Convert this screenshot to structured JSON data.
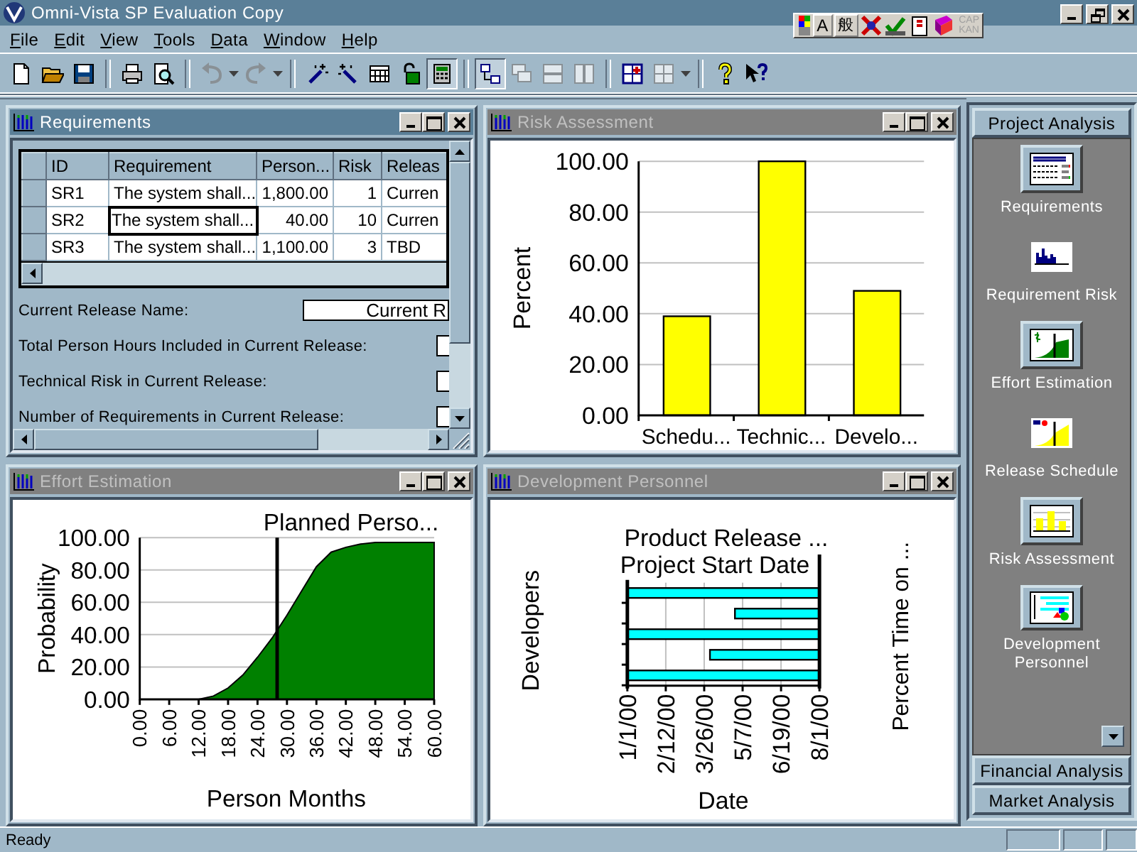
{
  "app": {
    "title": "Omni-Vista SP Evaluation Copy"
  },
  "ime_bar": {
    "mode": "A",
    "input": "般",
    "caps": "CAP",
    "kana": "KAN",
    "locks_disabled": true
  },
  "menu": [
    {
      "label": "File"
    },
    {
      "label": "Edit"
    },
    {
      "label": "View"
    },
    {
      "label": "Tools"
    },
    {
      "label": "Data"
    },
    {
      "label": "Window"
    },
    {
      "label": "Help"
    }
  ],
  "toolbar": [
    {
      "kind": "new",
      "pressed": false,
      "disabled": false
    },
    {
      "kind": "open",
      "pressed": false,
      "disabled": false
    },
    {
      "kind": "save",
      "pressed": false,
      "disabled": false
    },
    {
      "kind": "separator"
    },
    {
      "kind": "print",
      "pressed": false,
      "disabled": false
    },
    {
      "kind": "preview",
      "pressed": false,
      "disabled": false
    },
    {
      "kind": "separator"
    },
    {
      "kind": "undo",
      "pressed": false,
      "disabled": true,
      "dropdown": true
    },
    {
      "kind": "redo",
      "pressed": false,
      "disabled": true,
      "dropdown": true
    },
    {
      "kind": "separator"
    },
    {
      "kind": "wand",
      "pressed": false,
      "disabled": false
    },
    {
      "kind": "wand2",
      "pressed": false,
      "disabled": false
    },
    {
      "kind": "grid",
      "pressed": false,
      "disabled": false
    },
    {
      "kind": "lock",
      "pressed": false,
      "disabled": false
    },
    {
      "kind": "calculator",
      "pressed": true,
      "disabled": false
    },
    {
      "kind": "separator"
    },
    {
      "kind": "diagram",
      "pressed": true,
      "disabled": false
    },
    {
      "kind": "cascade",
      "pressed": false,
      "disabled": true
    },
    {
      "kind": "tileh",
      "pressed": false,
      "disabled": true
    },
    {
      "kind": "tilev",
      "pressed": false,
      "disabled": true
    },
    {
      "kind": "separator"
    },
    {
      "kind": "addwin",
      "pressed": false,
      "disabled": false
    },
    {
      "kind": "layout",
      "pressed": false,
      "disabled": true,
      "dropdown": true
    },
    {
      "kind": "separator"
    },
    {
      "kind": "help",
      "pressed": false,
      "disabled": false
    },
    {
      "kind": "contexthelp",
      "pressed": false,
      "disabled": false
    }
  ],
  "windows": [
    {
      "kind": "table",
      "title": "Requirements",
      "active": true,
      "columns": [
        "ID",
        "Requirement",
        "Person...",
        "Risk",
        "Releas"
      ],
      "rows": [
        {
          "id": "SR1",
          "requirement": "The system shall...",
          "person": "1,800.00",
          "risk": "1",
          "release": "Curren",
          "focused": false
        },
        {
          "id": "SR2",
          "requirement": "The system shall...",
          "person": "40.00",
          "risk": "10",
          "release": "Curren",
          "focused": true
        },
        {
          "id": "SR3",
          "requirement": "The system shall...",
          "person": "1,100.00",
          "risk": "3",
          "release": "TBD",
          "focused": false
        }
      ],
      "fields": [
        {
          "label": "Current Release Name:",
          "value": "Current R"
        },
        {
          "label": "Total Person Hours Included in Current Release:"
        },
        {
          "label": "Technical Risk in Current Release:"
        },
        {
          "label": "Number of Requirements in Current Release:"
        }
      ]
    },
    {
      "kind": "chart",
      "title": "Risk Assessment",
      "active": false,
      "chart_data": {
        "type": "bar",
        "grid": true,
        "ylabel": "Percent",
        "categories": [
          "Schedu...",
          "Technic...",
          "Develo..."
        ],
        "values": [
          39,
          100,
          49
        ],
        "ylim": [
          0,
          100
        ],
        "yticks": [
          {
            "value": 0,
            "label": "0.00"
          },
          {
            "value": 20,
            "label": "20.00"
          },
          {
            "value": 40,
            "label": "40.00"
          },
          {
            "value": 60,
            "label": "60.00"
          },
          {
            "value": 80,
            "label": "80.00"
          },
          {
            "value": 100,
            "label": "100.00"
          }
        ]
      }
    },
    {
      "kind": "chart",
      "title": "Effort Estimation",
      "active": false,
      "chart_data": {
        "type": "area",
        "grid": true,
        "xlabel": "Person Months",
        "ylabel": "Probability",
        "x": [
          0,
          3,
          6,
          9,
          12,
          15,
          18,
          21,
          24,
          27,
          30,
          33,
          36,
          39,
          42,
          45,
          48,
          51,
          54,
          57,
          60
        ],
        "values": [
          0,
          0,
          0,
          0,
          0,
          2,
          7,
          15,
          26,
          38,
          52,
          67,
          82,
          91,
          94,
          96,
          97,
          97,
          97,
          97,
          97
        ],
        "xlim": [
          0,
          60
        ],
        "ylim": [
          0,
          100
        ],
        "xticks": [
          {
            "value": 0,
            "label": "0.00"
          },
          {
            "value": 6,
            "label": "6.00"
          },
          {
            "value": 12,
            "label": "12.00"
          },
          {
            "value": 18,
            "label": "18.00"
          },
          {
            "value": 24,
            "label": "24.00"
          },
          {
            "value": 30,
            "label": "30.00"
          },
          {
            "value": 36,
            "label": "36.00"
          },
          {
            "value": 42,
            "label": "42.00"
          },
          {
            "value": 48,
            "label": "48.00"
          },
          {
            "value": 54,
            "label": "54.00"
          },
          {
            "value": 60,
            "label": "60.00"
          }
        ],
        "yticks": [
          {
            "value": 0,
            "label": "0.00"
          },
          {
            "value": 20,
            "label": "20.00"
          },
          {
            "value": 40,
            "label": "40.00"
          },
          {
            "value": 60,
            "label": "60.00"
          },
          {
            "value": 80,
            "label": "80.00"
          },
          {
            "value": 100,
            "label": "100.00"
          }
        ],
        "ref_lines": [
          {
            "axis": "x",
            "value": 28
          }
        ],
        "annotations": [
          "Planned Perso..."
        ]
      }
    },
    {
      "kind": "gantt",
      "title": "Development Personnel",
      "active": false,
      "release_label": "Product Release ...",
      "start_label": "Project Start Date",
      "ylabel": "Developers",
      "y2label": "Percent Time on ...",
      "xlabel": "Date",
      "tick_labels": [
        "1/1/00",
        "2/12/00",
        "3/26/00",
        "5/7/00",
        "6/19/00",
        "8/1/00"
      ]
    }
  ],
  "sidebar": {
    "header": "Project Analysis",
    "items": [
      {
        "label": "Requirements",
        "kind": "table",
        "open": true
      },
      {
        "label": "Requirement Risk",
        "kind": "histogram",
        "open": false
      },
      {
        "label": "Effort Estimation",
        "kind": "effort",
        "open": true
      },
      {
        "label": "Release Schedule",
        "kind": "schedule",
        "open": false
      },
      {
        "label": "Risk Assessment",
        "kind": "bars",
        "open": true
      },
      {
        "label": "Development Personnel",
        "kind": "gantt",
        "open": true
      }
    ],
    "groups": [
      "Financial Analysis",
      "Market Analysis"
    ]
  },
  "status_bar": {
    "text": "Ready"
  }
}
